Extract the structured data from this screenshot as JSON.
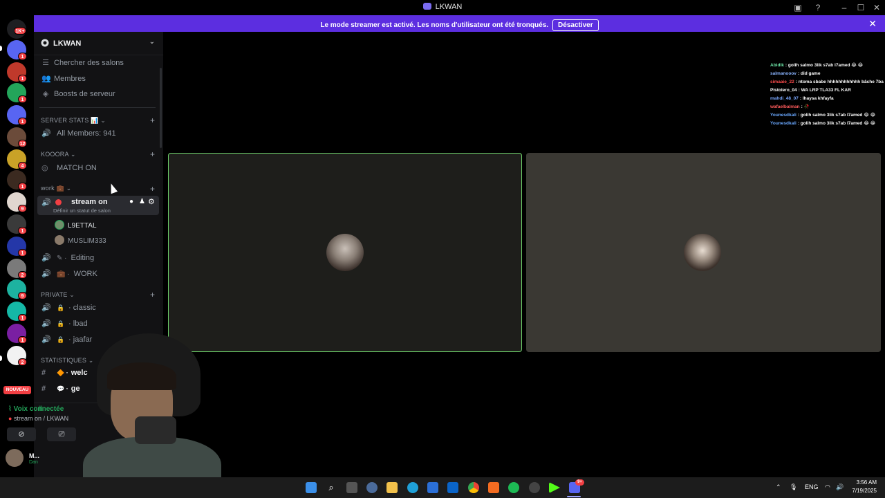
{
  "window": {
    "title": "LKWAN"
  },
  "banner": {
    "message": "Le mode streamer est activé. Les noms d'utilisateur ont été tronqués.",
    "button": "Désactiver"
  },
  "rail": {
    "top_badge": "1K+",
    "servers": [
      {
        "color": "#5865f2",
        "badge": "1"
      },
      {
        "color": "#c0392b",
        "badge": "1"
      },
      {
        "color": "#23a55a",
        "badge": "1"
      },
      {
        "color": "#5865f2",
        "badge": "1"
      },
      {
        "color": "#6b4b3a",
        "badge": "12"
      },
      {
        "color": "#c9a227",
        "badge": "4"
      },
      {
        "color": "#3b2a20",
        "badge": "1"
      },
      {
        "color": "#e0d6cf",
        "badge": "9"
      },
      {
        "color": "#3a3a3a",
        "badge": "1"
      },
      {
        "color": "#2437a8",
        "badge": "1"
      },
      {
        "color": "#7a7a7a",
        "badge": "2"
      },
      {
        "color": "#1db2a0",
        "badge": "9"
      },
      {
        "color": "#15b8a6",
        "badge": "1"
      },
      {
        "color": "#7a1fa2",
        "badge": "1"
      },
      {
        "color": "#f2f2f2",
        "badge": "2"
      }
    ],
    "new_label": "NOUVEAU"
  },
  "sidebar": {
    "server_name": "LKWAN",
    "top_items": [
      {
        "label": "Chercher des salons",
        "icon": "browse-icon"
      },
      {
        "label": "Membres",
        "icon": "members-icon"
      },
      {
        "label": "Boosts de serveur",
        "icon": "boost-icon"
      }
    ],
    "cat_server_stats": "SERVER STATS 📊",
    "chan_all_members": "All Members: 941",
    "cat_koora": "KOOORA",
    "chan_match": "MATCH ON",
    "cat_work": "work 💼",
    "active_channel": "stream on",
    "active_status": "Définir un statut de salon",
    "voice_users": [
      {
        "name": "L9ETTAL",
        "avatar": "#6f8f6a"
      },
      {
        "name": "MUSLIM333",
        "avatar": "#8a7a6a"
      }
    ],
    "chan_editing": "Editing",
    "chan_work": "WORK",
    "cat_private": "PRIVATE",
    "private_channels": [
      "classic",
      "lbad",
      "jaafar"
    ],
    "cat_stats": "STATISTIQUES",
    "text_channels": [
      "welc",
      "ge"
    ]
  },
  "voice_panel": {
    "status": "Voix connectée",
    "channel": "stream on / LKWAN",
    "username": "M...",
    "user_status": "Dan"
  },
  "chat": [
    {
      "user": "Abidlk",
      "color": "#6ee7a8",
      "text": "golih salmo 3lik s7ab l7amed 😂 😂"
    },
    {
      "user": "salmanooov",
      "color": "#8ab4ff",
      "text": "did game"
    },
    {
      "user": "simaaie_22",
      "color": "#ff4d4d",
      "text": "ntoma sbabe hhhhhhhhhhhh bâche 7ba"
    },
    {
      "user": "Pistolero_04",
      "color": "#ffffff",
      "text": "WA LRP TLA33 FL KAR"
    },
    {
      "user": "mahdi_48_07",
      "color": "#7aa7ff",
      "text": "lhaysa khfayfa"
    },
    {
      "user": "wafaelbalman",
      "color": "#ff5c5c",
      "text": "🥀"
    },
    {
      "user": "Younesdkali",
      "color": "#6aa8ff",
      "text": "golih salmo 3lik s7ab l7amed 😂 😂"
    },
    {
      "user": "Younesdkali",
      "color": "#6aa8ff",
      "text": "golih salmo 3lik s7ab l7amed 😂 😂"
    }
  ],
  "taskbar": {
    "lang": "ENG",
    "time": "3:56 AM",
    "date": "7/19/2025",
    "discord_badge": "9+"
  }
}
